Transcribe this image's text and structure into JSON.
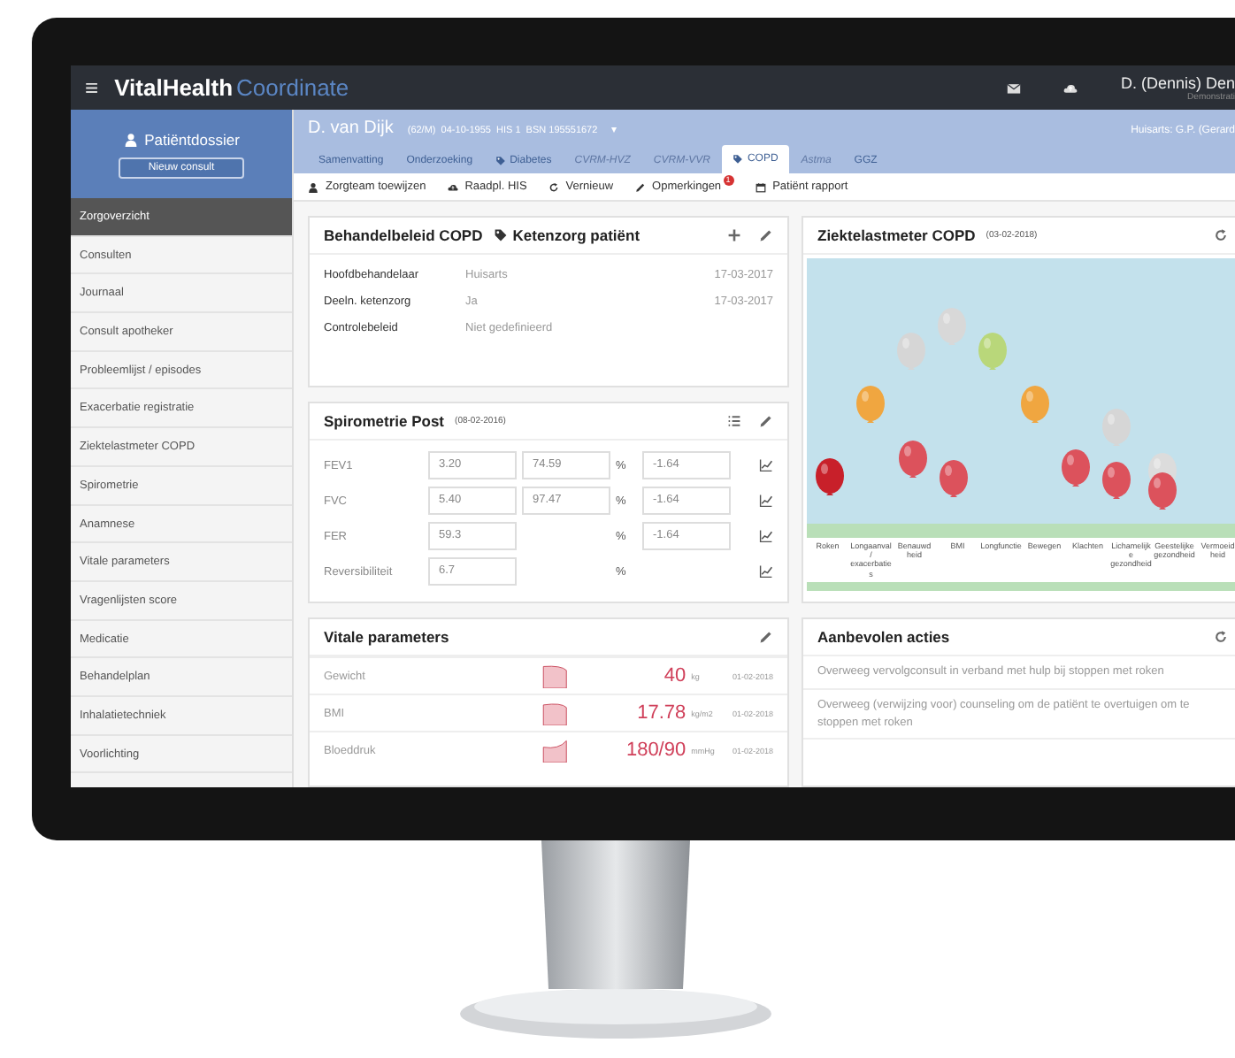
{
  "top_bar": {
    "menu_glyph": "≡",
    "brand": "VitalHealth",
    "brand_suffix": "Coordinate",
    "user_name": "D. (Dennis) Den",
    "user_role": "Demonstrati"
  },
  "sidebar": {
    "title": "Patiëntdossier",
    "new_button": "Nieuw consult",
    "items": [
      {
        "label": "Zorgoverzicht",
        "selected": true
      },
      {
        "label": "Consulten",
        "selected": false
      },
      {
        "label": "Journaal",
        "selected": false
      },
      {
        "label": "Consult apotheker",
        "selected": false
      },
      {
        "label": "Probleemlijst / episodes",
        "selected": false
      },
      {
        "label": "Exacerbatie registratie",
        "selected": false
      },
      {
        "label": "Ziektelastmeter COPD",
        "selected": false
      },
      {
        "label": "Spirometrie",
        "selected": false
      },
      {
        "label": "Anamnese",
        "selected": false
      },
      {
        "label": "Vitale parameters",
        "selected": false
      },
      {
        "label": "Vragenlijsten score",
        "selected": false
      },
      {
        "label": "Medicatie",
        "selected": false
      },
      {
        "label": "Behandelplan",
        "selected": false
      },
      {
        "label": "Inhalatietechniek",
        "selected": false
      },
      {
        "label": "Voorlichting",
        "selected": false
      }
    ]
  },
  "patient": {
    "name": "D. van Dijk",
    "details": "(62/M)  04-10-1955  HIS 1  BSN 195551672",
    "menu_glyph": "▾",
    "practitioner": "Huisarts: G.P. (Gerard"
  },
  "tabs": [
    {
      "label": "Samenvatting",
      "kind": "plain",
      "selected": false,
      "disabled": false
    },
    {
      "label": "Onderzoeking",
      "kind": "plain",
      "selected": false,
      "disabled": false
    },
    {
      "label": "Diabetes",
      "kind": "tagged",
      "selected": false,
      "disabled": false
    },
    {
      "label": "CVRM-HVZ",
      "kind": "plain",
      "selected": false,
      "disabled": true
    },
    {
      "label": "CVRM-VVR",
      "kind": "plain",
      "selected": false,
      "disabled": true
    },
    {
      "label": "COPD",
      "kind": "tagged",
      "selected": true,
      "disabled": false
    },
    {
      "label": "Astma",
      "kind": "plain",
      "selected": false,
      "disabled": true
    },
    {
      "label": "GGZ",
      "kind": "plain",
      "selected": false,
      "disabled": false
    }
  ],
  "toolbar": [
    {
      "label": "Zorgteam toewijzen",
      "kind": "person"
    },
    {
      "label": "Raadpl. HIS",
      "kind": "cloud"
    },
    {
      "label": "Vernieuw",
      "kind": "refresh"
    },
    {
      "label": "Opmerkingen",
      "kind": "pencil",
      "badge": "1"
    },
    {
      "label": "Patiënt rapport",
      "kind": "calendar"
    }
  ],
  "treatment_card": {
    "title": "Behandelbeleid COPD",
    "subtitle": "Ketenzorg patiënt",
    "rows": [
      {
        "label": "Hoofdbehandelaar",
        "value": "Huisarts",
        "date": "17-03-2017"
      },
      {
        "label": "Deeln. ketenzorg",
        "value": "Ja",
        "date": "17-03-2017"
      },
      {
        "label": "Controlebeleid",
        "value": "Niet gedefinieerd"
      }
    ]
  },
  "spirometry_card": {
    "title": "Spirometrie Post",
    "date": "(08-02-2016)",
    "rows": [
      {
        "label": "FEV1",
        "value": "3.20",
        "percent": "74.59",
        "unit": "%",
        "z_score": "-1.64"
      },
      {
        "label": "FVC",
        "value": "5.40",
        "percent": "97.47",
        "unit": "%",
        "z_score": "-1.64"
      },
      {
        "label": "FER",
        "value": "59.3",
        "unit": "%",
        "z_score": "-1.64"
      },
      {
        "label": "Reversibiliteit",
        "value": "6.7",
        "unit": "%"
      }
    ]
  },
  "vitals_card": {
    "title": "Vitale parameters",
    "rows": [
      {
        "label": "Gewicht",
        "value": "40",
        "unit": "kg",
        "date": "01-02-2018"
      },
      {
        "label": "BMI",
        "value": "17.78",
        "unit": "kg/m2",
        "date": "01-02-2018"
      },
      {
        "label": "Bloeddruk",
        "value": "180/90",
        "unit": "mmHg",
        "date": "01-02-2018"
      }
    ]
  },
  "burden_card": {
    "title": "Ziektelastmeter COPD",
    "date": "(03-02-2018)",
    "column_labels": [
      "Roken",
      "Longaanval / exacerbaties",
      "Benauwd heid",
      "BMI",
      "Longfunctie",
      "Bewegen",
      "Klachten",
      "Lichamelijke gezondheid",
      "Geestelijke gezondheid",
      "Vermoeid heid"
    ]
  },
  "actions_card": {
    "title": "Aanbevolen acties",
    "items": [
      "Overweeg vervolgconsult in verband met hulp bij stoppen met roken",
      "Overweeg (verwijzing voor) counseling om de patiënt te overtuigen om te stoppen met roken"
    ]
  }
}
